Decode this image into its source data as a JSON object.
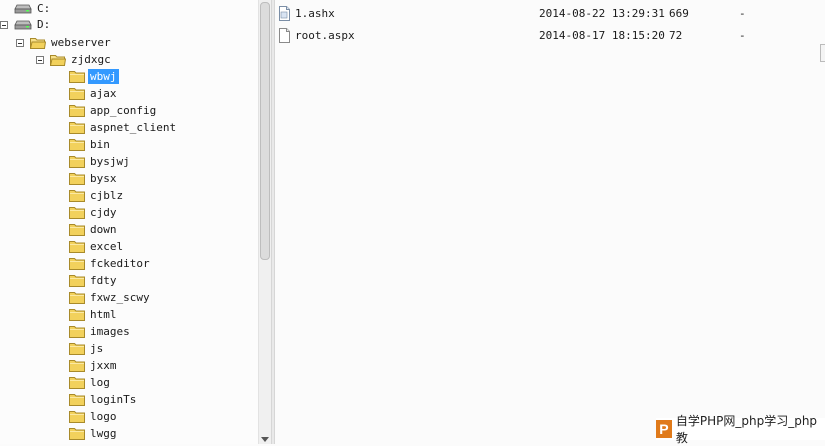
{
  "tree": {
    "drives": [
      {
        "label": "C:"
      },
      {
        "label": "D:"
      }
    ],
    "webserver": {
      "label": "webserver"
    },
    "zjdxgc": {
      "label": "zjdxgc"
    },
    "folders": [
      {
        "label": "wbwj"
      },
      {
        "label": "ajax"
      },
      {
        "label": "app_config"
      },
      {
        "label": "aspnet_client"
      },
      {
        "label": "bin"
      },
      {
        "label": "bysjwj"
      },
      {
        "label": "bysx"
      },
      {
        "label": "cjblz"
      },
      {
        "label": "cjdy"
      },
      {
        "label": "down"
      },
      {
        "label": "excel"
      },
      {
        "label": "fckeditor"
      },
      {
        "label": "fdty"
      },
      {
        "label": "fxwz_scwy"
      },
      {
        "label": "html"
      },
      {
        "label": "images"
      },
      {
        "label": "js"
      },
      {
        "label": "jxxm"
      },
      {
        "label": "log"
      },
      {
        "label": "loginTs"
      },
      {
        "label": "logo"
      },
      {
        "label": "lwgg"
      }
    ],
    "selected": "wbwj"
  },
  "files": [
    {
      "name": "1.ashx",
      "date": "2014-08-22 13:29:31",
      "size": "669",
      "perm": "-"
    },
    {
      "name": "root.aspx",
      "date": "2014-08-17 18:15:20",
      "size": "72",
      "perm": "-"
    }
  ],
  "watermark": {
    "logo_letter": "P",
    "text": "自学PHP网_php学习_php教"
  },
  "colors": {
    "selection": "#3399ff",
    "folder": "#f2d15c",
    "watermark_logo": "#e07a1a"
  }
}
